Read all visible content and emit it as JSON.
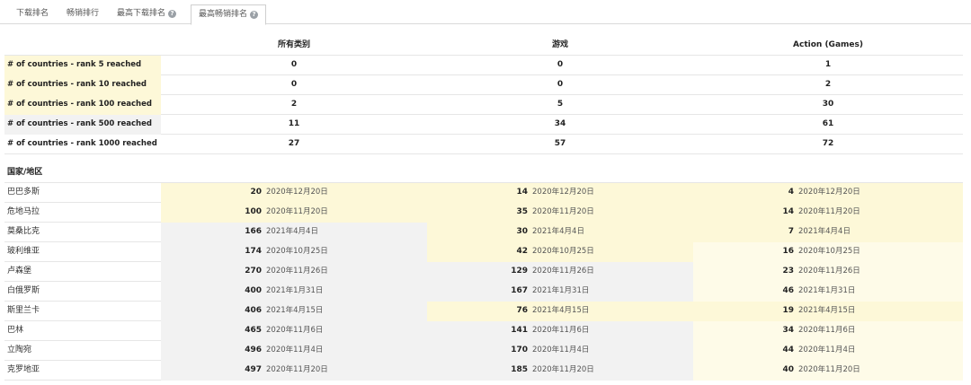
{
  "tabs": [
    {
      "label": "下载排名",
      "help": false
    },
    {
      "label": "畅销排行",
      "help": false
    },
    {
      "label": "最高下载排名",
      "help": true
    },
    {
      "label": "最高畅销排名",
      "help": true,
      "active": true
    }
  ],
  "columns": [
    "所有类别",
    "游戏",
    "Action (Games)"
  ],
  "summary_rows": [
    {
      "label": "# of countries - rank 5 reached",
      "values": [
        "0",
        "0",
        "1"
      ]
    },
    {
      "label": "# of countries - rank 10 reached",
      "values": [
        "0",
        "0",
        "2"
      ]
    },
    {
      "label": "# of countries - rank 100 reached",
      "values": [
        "2",
        "5",
        "30"
      ]
    },
    {
      "label": "# of countries - rank 500 reached",
      "values": [
        "11",
        "34",
        "61"
      ]
    },
    {
      "label": "# of countries - rank 1000 reached",
      "values": [
        "27",
        "57",
        "72"
      ]
    }
  ],
  "section_label": "国家/地区",
  "country_rows": [
    {
      "country": "巴巴多斯",
      "cells": [
        [
          "20",
          "2020年12月20日"
        ],
        [
          "14",
          "2020年12月20日"
        ],
        [
          "4",
          "2020年12月20日"
        ]
      ]
    },
    {
      "country": "危地马拉",
      "cells": [
        [
          "100",
          "2020年11月20日"
        ],
        [
          "35",
          "2020年11月20日"
        ],
        [
          "14",
          "2020年11月20日"
        ]
      ]
    },
    {
      "country": "莫桑比克",
      "cells": [
        [
          "166",
          "2021年4月4日"
        ],
        [
          "30",
          "2021年4月4日"
        ],
        [
          "7",
          "2021年4月4日"
        ]
      ]
    },
    {
      "country": "玻利维亚",
      "cells": [
        [
          "174",
          "2020年10月25日"
        ],
        [
          "42",
          "2020年10月25日"
        ],
        [
          "16",
          "2020年10月25日"
        ]
      ]
    },
    {
      "country": "卢森堡",
      "cells": [
        [
          "270",
          "2020年11月26日"
        ],
        [
          "129",
          "2020年11月26日"
        ],
        [
          "23",
          "2020年11月26日"
        ]
      ]
    },
    {
      "country": "白俄罗斯",
      "cells": [
        [
          "400",
          "2021年1月31日"
        ],
        [
          "167",
          "2021年1月31日"
        ],
        [
          "46",
          "2021年1月31日"
        ]
      ]
    },
    {
      "country": "斯里兰卡",
      "cells": [
        [
          "406",
          "2021年4月15日"
        ],
        [
          "76",
          "2021年4月15日"
        ],
        [
          "19",
          "2021年4月15日"
        ]
      ]
    },
    {
      "country": "巴林",
      "cells": [
        [
          "465",
          "2020年11月6日"
        ],
        [
          "141",
          "2020年11月6日"
        ],
        [
          "34",
          "2020年11月6日"
        ]
      ]
    },
    {
      "country": "立陶宛",
      "cells": [
        [
          "496",
          "2020年11月4日"
        ],
        [
          "170",
          "2020年11月4日"
        ],
        [
          "44",
          "2020年11月4日"
        ]
      ]
    },
    {
      "country": "克罗地亚",
      "cells": [
        [
          "497",
          "2020年11月20日"
        ],
        [
          "185",
          "2020年11月20日"
        ],
        [
          "40",
          "2020年11月20日"
        ]
      ]
    }
  ],
  "colors": {
    "highlight": "#fdf8d8",
    "gray": "#f2f2f2"
  }
}
